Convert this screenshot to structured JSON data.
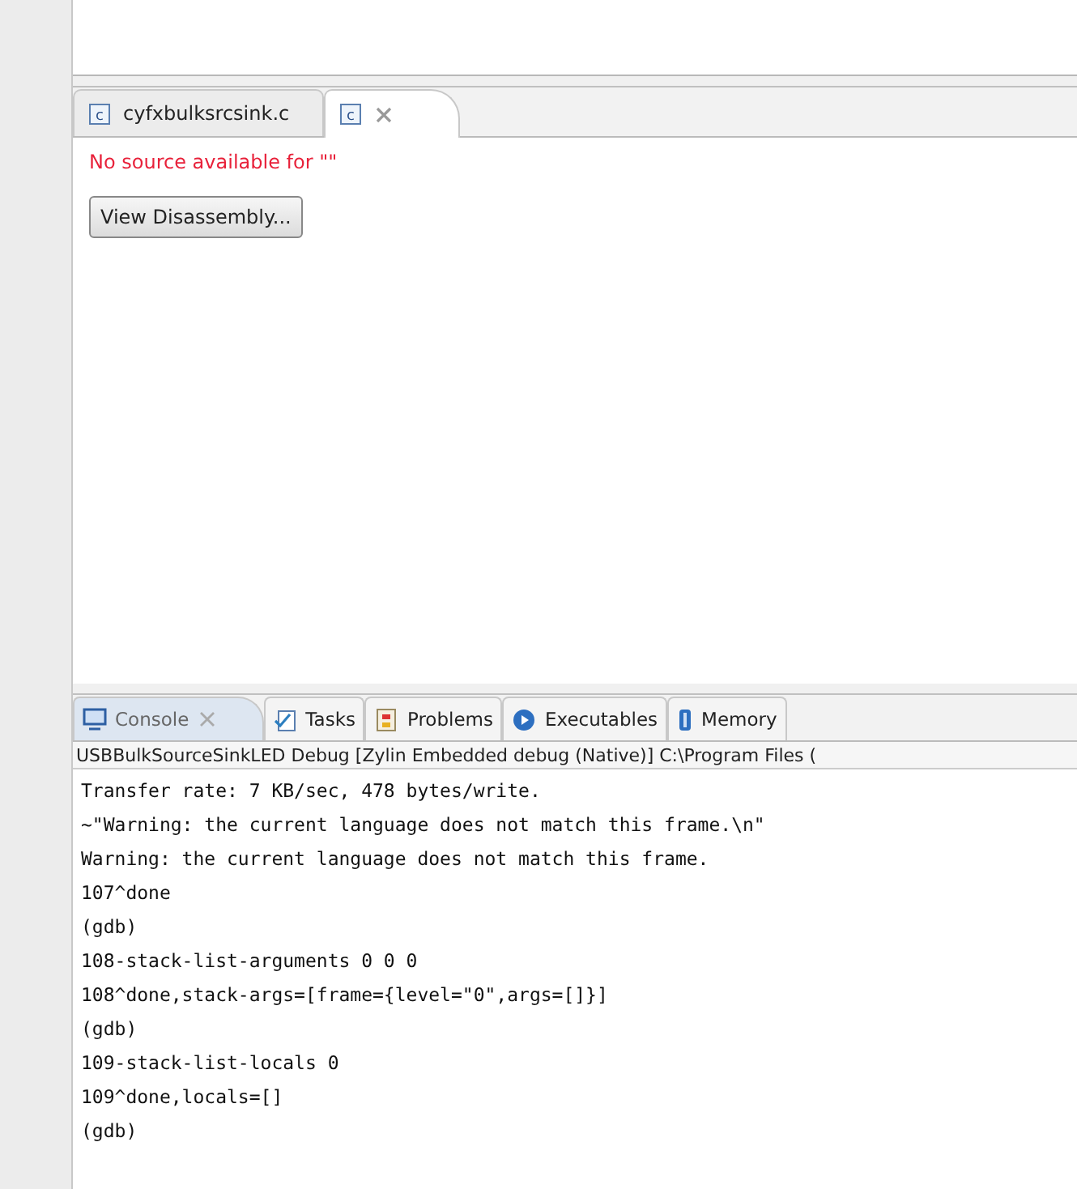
{
  "editor": {
    "tabs": [
      {
        "icon": "c",
        "label": "cyfxbulksrcsink.c",
        "selected": false,
        "closable": false
      },
      {
        "icon": "c",
        "selected": true,
        "closable": true
      }
    ],
    "message": "No source available for \"\"",
    "button": "View Disassembly..."
  },
  "console": {
    "tabs": [
      {
        "label": "Console",
        "kind": "console",
        "selected": true,
        "closable": true
      },
      {
        "label": "Tasks",
        "kind": "tasks",
        "selected": false,
        "closable": false
      },
      {
        "label": "Problems",
        "kind": "problems",
        "selected": false,
        "closable": false
      },
      {
        "label": "Executables",
        "kind": "executables",
        "selected": false,
        "closable": false
      },
      {
        "label": "Memory",
        "kind": "memory",
        "selected": false,
        "closable": false
      }
    ],
    "header": "USBBulkSourceSinkLED Debug [Zylin Embedded debug (Native)] C:\\Program Files (",
    "lines": [
      "Transfer rate: 7 KB/sec, 478 bytes/write.",
      "~\"Warning: the current language does not match this frame.\\n\"",
      "Warning: the current language does not match this frame.",
      "107^done",
      "(gdb)",
      "108-stack-list-arguments 0 0 0",
      "108^done,stack-args=[frame={level=\"0\",args=[]}]",
      "(gdb)",
      "109-stack-list-locals 0",
      "109^done,locals=[]",
      "(gdb)"
    ]
  }
}
